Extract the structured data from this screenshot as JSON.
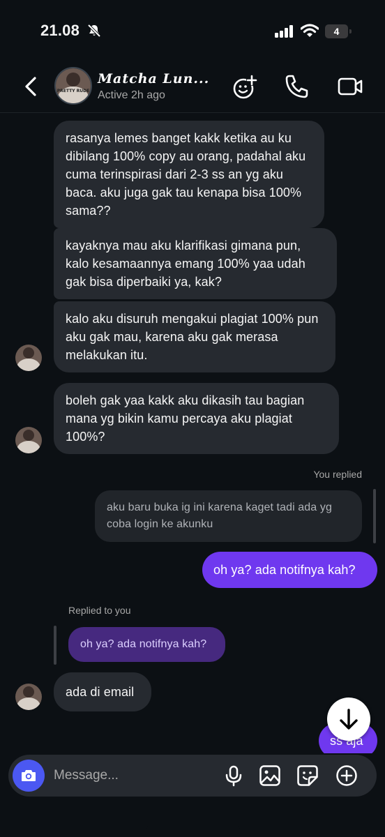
{
  "status_bar": {
    "time": "21.08",
    "battery": "4"
  },
  "header": {
    "contact_name": "Matcha Lun...",
    "status": "Active 2h ago"
  },
  "avatar": {
    "shirt_text": "PRETTY RUDE"
  },
  "messages": [
    {
      "text": "rasanya lemes banget kakk ketika au ku dibilang 100% copy au orang, padahal aku cuma terinspirasi dari 2-3 ss an yg aku baca. aku juga gak tau kenapa bisa 100% sama??"
    },
    {
      "text": "kayaknya mau aku klarifikasi gimana pun, kalo kesamaannya emang 100% yaa udah gak bisa diperbaiki ya, kak?"
    },
    {
      "text": "kalo aku disuruh mengakui plagiat 100% pun aku gak mau, karena aku gak merasa melakukan itu."
    },
    {
      "text": "boleh gak yaa kakk aku dikasih tau bagian mana yg bikin kamu percaya aku plagiat 100%?"
    },
    {
      "text": "oh ya? ada notifnya kah?"
    },
    {
      "text": "ada di email"
    },
    {
      "text": "ss aja"
    }
  ],
  "reply_out": {
    "label": "You replied",
    "quoted": "aku baru buka ig ini karena kaget tadi ada yg coba login ke akunku"
  },
  "reply_in": {
    "label": "Replied to you",
    "quoted": "oh ya? ada notifnya kah?"
  },
  "composer": {
    "placeholder": "Message..."
  },
  "colors": {
    "background": "#0c1014",
    "incoming_bubble": "#262a30",
    "outgoing_bubble": "#6f38ef",
    "camera_button": "#4b58f2"
  }
}
